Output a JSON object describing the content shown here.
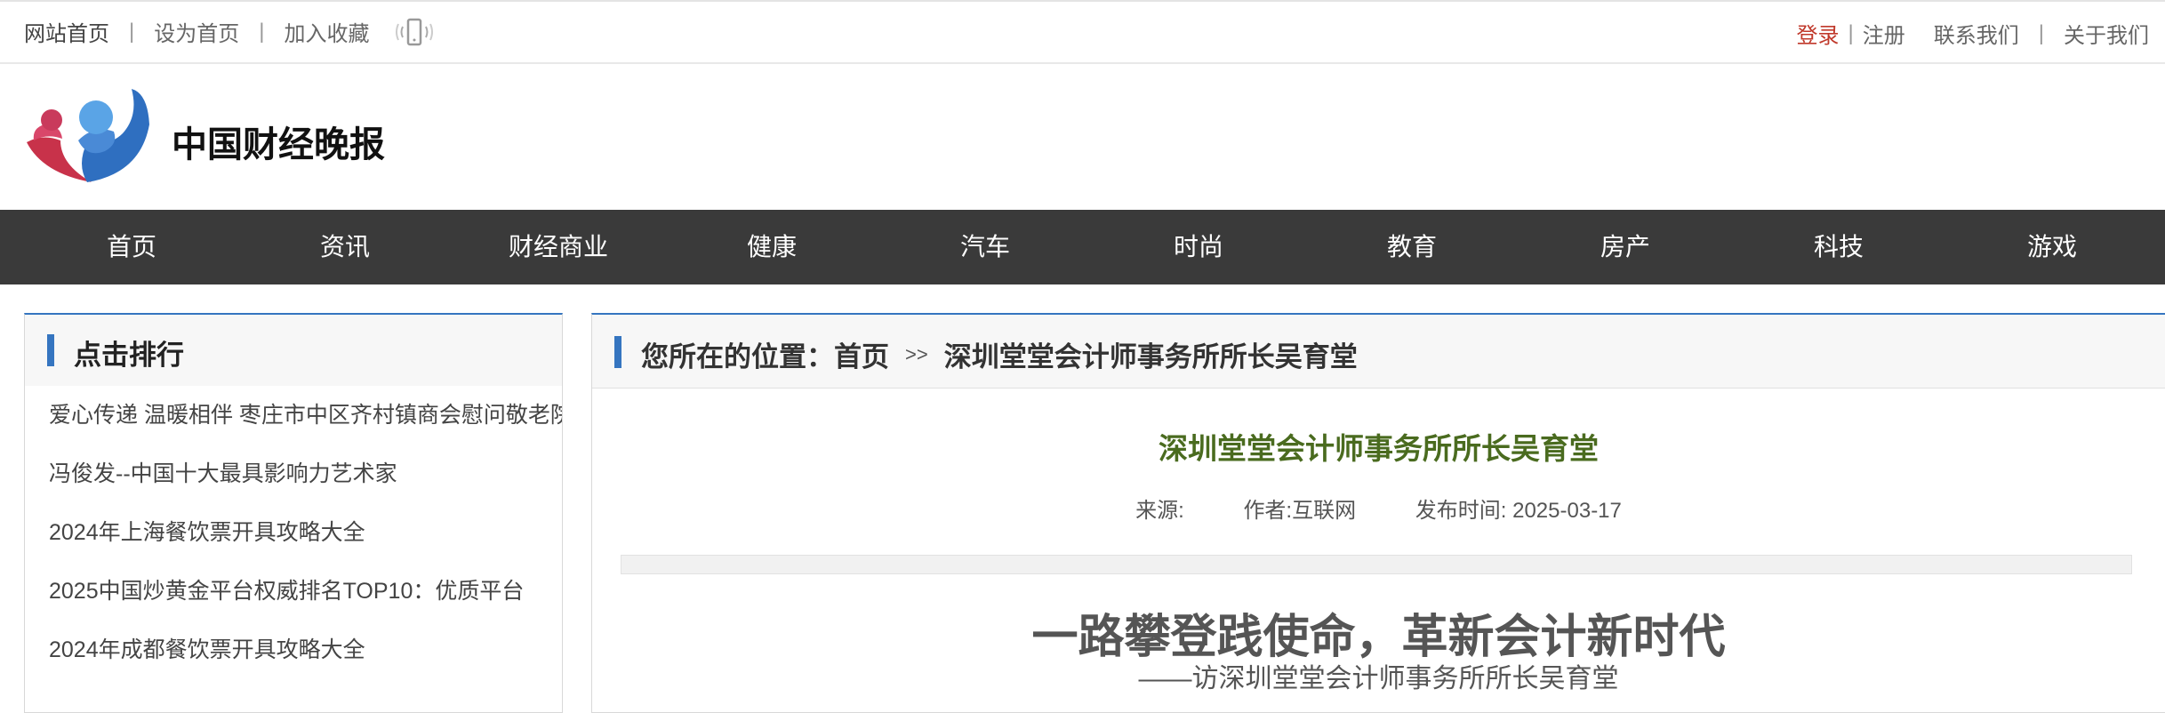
{
  "topbar": {
    "home": "网站首页",
    "set_home": "设为首页",
    "favorite": "加入收藏",
    "sep": "|",
    "login": "登录",
    "register": "注册",
    "contact": "联系我们",
    "about": "关于我们"
  },
  "site": {
    "name": "中国财经晚报"
  },
  "nav": [
    "首页",
    "资讯",
    "财经商业",
    "健康",
    "汽车",
    "时尚",
    "教育",
    "房产",
    "科技",
    "游戏"
  ],
  "sidebar": {
    "title": "点击排行",
    "items": [
      "爱心传递 温暖相伴 枣庄市中区齐村镇商会慰问敬老院",
      "冯俊发--中国十大最具影响力艺术家",
      "2024年上海餐饮票开具攻略大全",
      "2025中国炒黄金平台权威排名TOP10：优质平台",
      "2024年成都餐饮票开具攻略大全"
    ]
  },
  "main": {
    "location_label": "您所在的位置：",
    "crumb_home": "首页",
    "crumb_arrow": ">>",
    "crumb_current": "深圳堂堂会计师事务所所长吴育堂",
    "article_title": "深圳堂堂会计师事务所所长吴育堂",
    "meta_source": "来源:",
    "meta_author": "作者:互联网",
    "meta_date": "发布时间: 2025-03-17",
    "headline": "一路攀登践使命，革新会计新时代",
    "subhead": "——访深圳堂堂会计师事务所所长吴育堂"
  },
  "colors": {
    "accent": "#3575c0",
    "nav_bg": "#3a3a3a",
    "title_green": "#4a6b1f",
    "login_red": "#c0392b"
  }
}
